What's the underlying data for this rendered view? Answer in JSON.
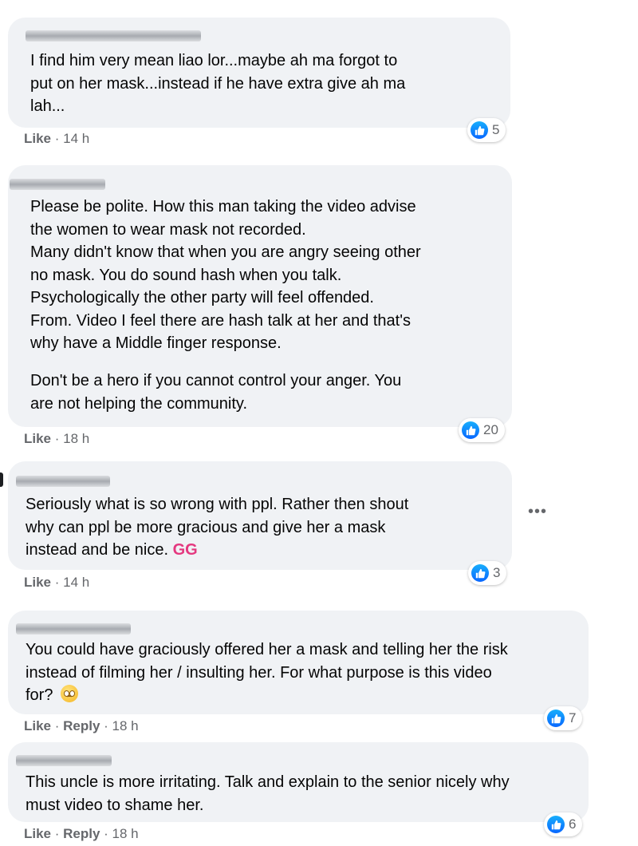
{
  "comments": [
    {
      "lines": [
        "I find him very mean liao lor...maybe ah ma forgot to",
        "put on her mask...instead if he have extra give ah ma",
        "lah..."
      ],
      "actions": {
        "like": "Like",
        "time": "14 h"
      },
      "reactions": "5"
    },
    {
      "lines": [
        "Please be polite. How this man taking the video advise",
        "the women to wear mask not recorded.",
        "Many didn't know that when you are angry seeing other",
        "no mask. You do sound hash when you talk.",
        "Psychologically the other party will feel offended.",
        "From. Video I feel there are hash talk at her and that's",
        "why have a Middle finger response."
      ],
      "lines2": [
        "Don't be a hero if you cannot control your anger. You",
        "are not helping the community."
      ],
      "actions": {
        "like": "Like",
        "time": "18 h"
      },
      "reactions": "20"
    },
    {
      "lines": [
        "Seriously what is so wrong with ppl. Rather then shout",
        "why can ppl be more gracious and give her a mask"
      ],
      "line3": "instead and be nice.",
      "tag": "GG",
      "actions": {
        "like": "Like",
        "time": "14 h"
      },
      "reactions": "3"
    },
    {
      "lines": [
        "You could have graciously offered her a mask and telling her the risk",
        "instead of filming her / insulting her. For what purpose is this video"
      ],
      "line3": "for?",
      "emoji": "worried-face",
      "actions": {
        "like": "Like",
        "reply": "Reply",
        "time": "18 h"
      },
      "reactions": "7"
    },
    {
      "lines": [
        "This uncle is more irritating. Talk and explain to the senior nicely why",
        "must video to shame her."
      ],
      "actions": {
        "like": "Like",
        "reply": "Reply",
        "time": "18 h"
      },
      "reactions": "6"
    }
  ],
  "more_options": "•••",
  "icons": {
    "reaction": "like-icon",
    "more": "more-options-icon"
  },
  "colors": {
    "bubble": "#f0f2f5",
    "meta": "#65676b",
    "like_blue": "#0866ff",
    "tag_pink": "#e4387f"
  }
}
